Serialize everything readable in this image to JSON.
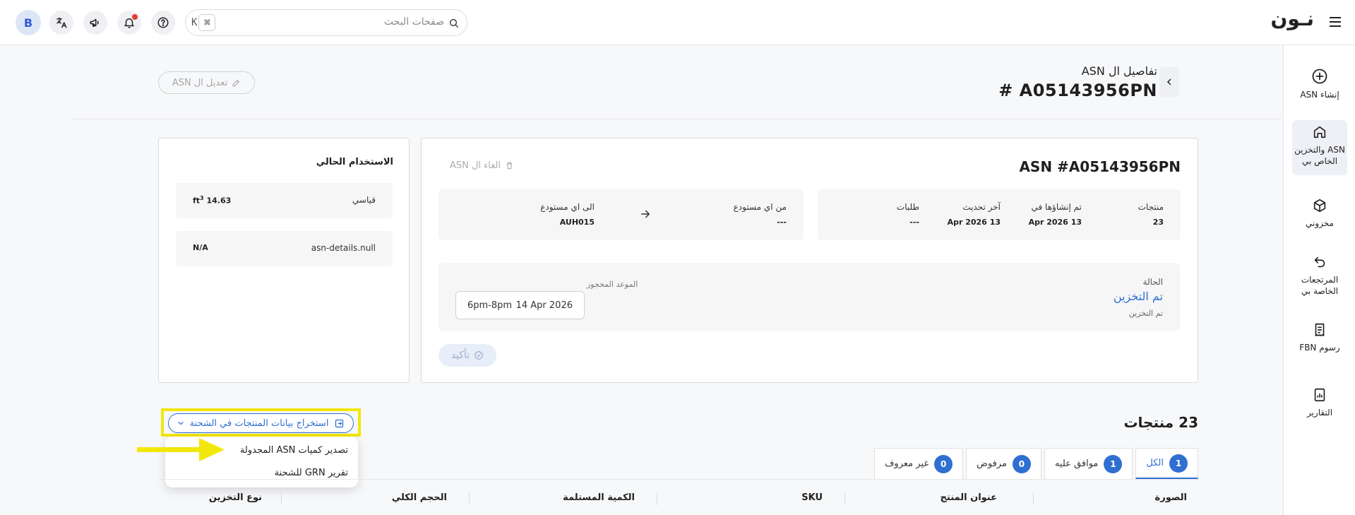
{
  "topbar": {
    "logo": "نـون",
    "search_placeholder": "صفحات البحث",
    "shortcut_key": "K",
    "shortcut_mod": "⌘",
    "avatar_initial": "B"
  },
  "sidebar": {
    "items": [
      {
        "label": "إنشاء ASN",
        "icon": "plus-circle-icon"
      },
      {
        "label": "ASN والتخزين الخاص بي",
        "icon": "home-icon"
      },
      {
        "label": "مخزوني",
        "icon": "box-icon"
      },
      {
        "label": "المرتجعات الخاصة بي",
        "icon": "return-icon"
      },
      {
        "label": "رسوم FBN",
        "icon": "receipt-icon"
      },
      {
        "label": "التقارير",
        "icon": "report-icon"
      }
    ]
  },
  "header": {
    "subtitle": "تفاصيل ال ASN",
    "title": "A05143956PN #",
    "edit_label": "تعديل ال ASN"
  },
  "asn": {
    "title": "ASN #A05143956PN",
    "cancel_label": "الغاء ال ASN",
    "stats": [
      {
        "label": "منتجات",
        "value": "23"
      },
      {
        "label": "تم إنشاؤها في",
        "value": "13 Apr 2026"
      },
      {
        "label": "آخر تحديث",
        "value": "13 Apr 2026"
      },
      {
        "label": "طلبات",
        "value": "---"
      }
    ],
    "from_label": "من اي مستودع",
    "from_value": "---",
    "to_label": "الى اي مستودع",
    "to_value": "AUH015",
    "status_label": "الحالة",
    "status_value": "تم التخزين",
    "status_sub": "تم التخزين",
    "slot_label": "الموعد المحجوز",
    "slot_date": "14 Apr 2026",
    "slot_time": "6pm-8pm",
    "confirm_label": "تأكيد"
  },
  "usage": {
    "title": "الاستخدام الحالي",
    "rows": [
      {
        "key": "قياسي",
        "value": "14.63",
        "unit": "ft",
        "unit_sup": "3"
      },
      {
        "key": "asn-details.null",
        "value": "N/A"
      }
    ]
  },
  "products": {
    "title": "23 منتجات",
    "export_label": "استخراج بيانات المنتجات في الشحنة",
    "dropdown": [
      "تصدير كميات ASN المجدولة",
      "تقرير GRN للشحنة"
    ],
    "tabs": [
      {
        "label": "الكل",
        "count": "1"
      },
      {
        "label": "موافق عليه",
        "count": "1"
      },
      {
        "label": "مرفوض",
        "count": "0"
      },
      {
        "label": "غير معروف",
        "count": "0"
      }
    ],
    "columns": [
      "الصورة",
      "عنوان المنتج",
      "SKU",
      "الكمية المستلمة",
      "الحجم الكلي",
      "نوع التخزين"
    ]
  },
  "colors": {
    "accent": "#2f6fd1",
    "highlight": "#f2e70b",
    "notification": "#e53935"
  }
}
